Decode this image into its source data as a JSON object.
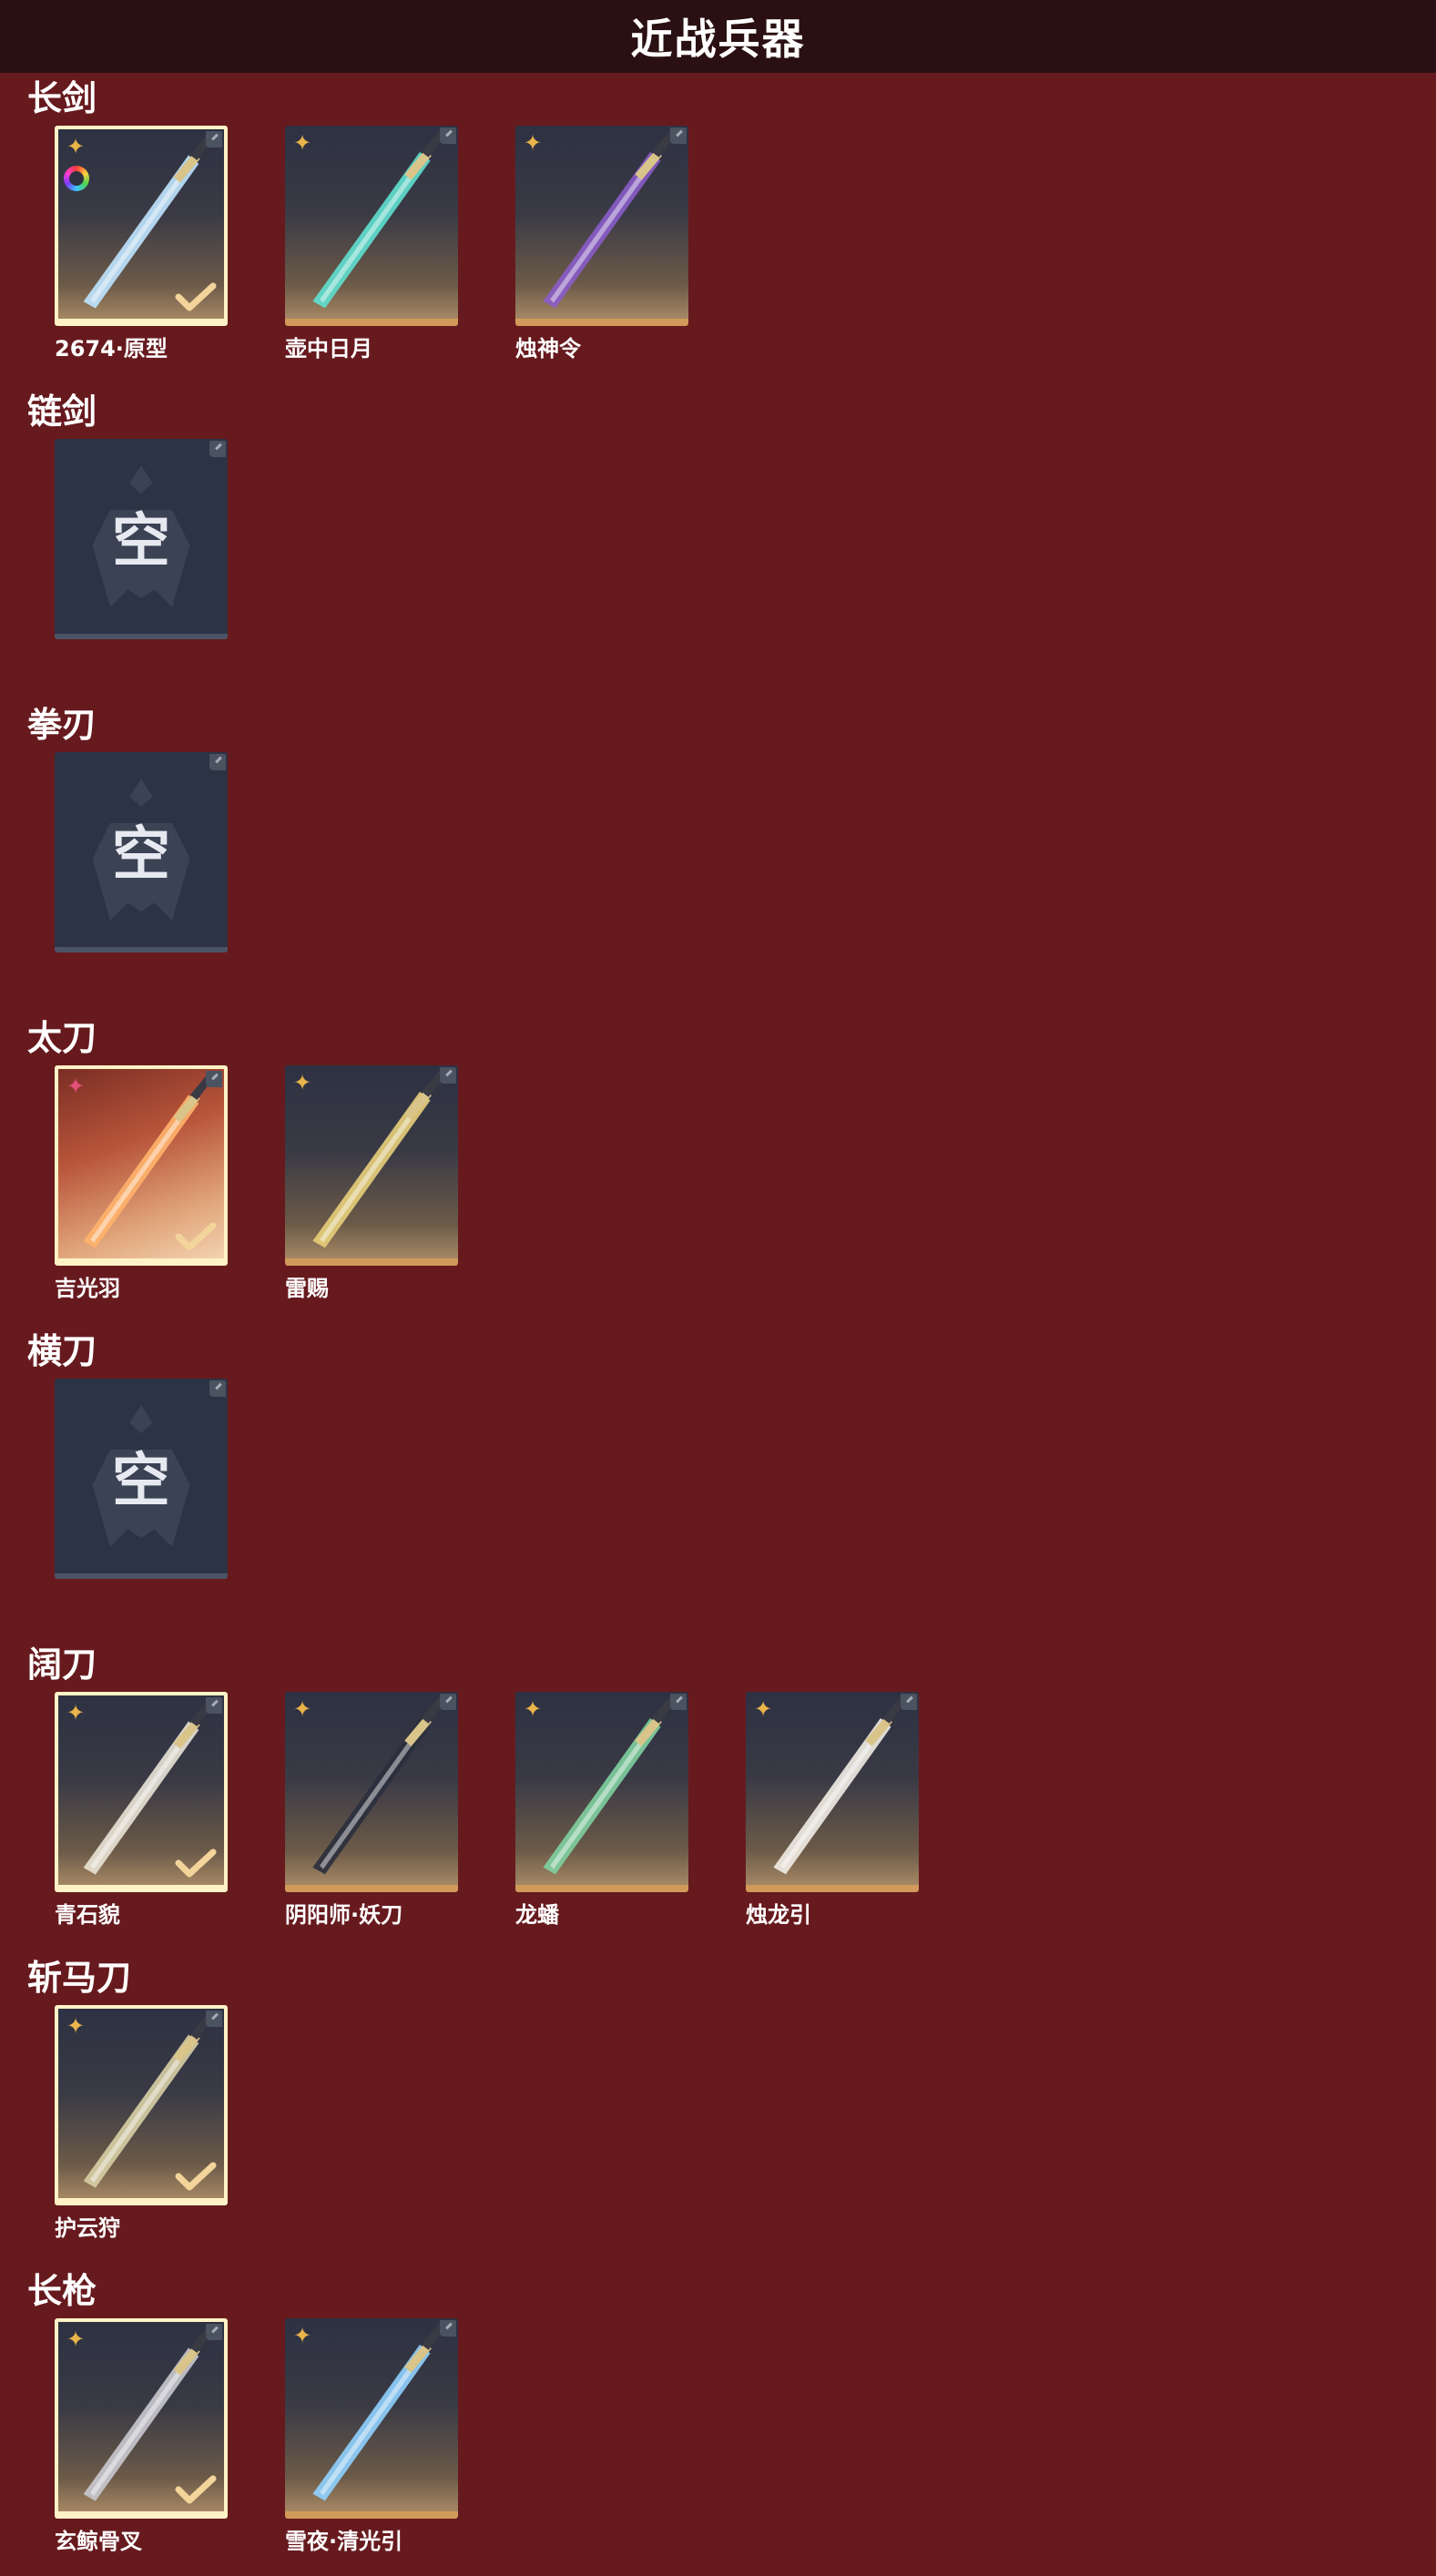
{
  "header": {
    "title": "近战兵器"
  },
  "sections": [
    {
      "title": "长剑",
      "items": [
        {
          "name": "2674·原型",
          "selected": true,
          "star": "gold",
          "ring": true,
          "blade_color": "#bfe4ff"
        },
        {
          "name": "壶中日月",
          "selected": false,
          "star": "gold",
          "blade_color": "#5fe0d0"
        },
        {
          "name": "烛神令",
          "selected": false,
          "star": "gold",
          "blade_color": "#8a5cc9"
        }
      ]
    },
    {
      "title": "链剑",
      "items": [
        {
          "empty": true,
          "empty_label": "空"
        }
      ]
    },
    {
      "title": "拳刃",
      "items": [
        {
          "empty": true,
          "empty_label": "空"
        }
      ]
    },
    {
      "title": "太刀",
      "items": [
        {
          "name": "吉光羽",
          "selected": true,
          "star": "pink",
          "blade_color": "#ffb36b"
        },
        {
          "name": "雷赐",
          "selected": false,
          "star": "gold",
          "blade_color": "#e8cf7a"
        }
      ]
    },
    {
      "title": "横刀",
      "items": [
        {
          "empty": true,
          "empty_label": "空"
        }
      ]
    },
    {
      "title": "阔刀",
      "items": [
        {
          "name": "青石貌",
          "selected": true,
          "star": "gold",
          "blade_color": "#e9e3d6"
        },
        {
          "name": "阴阳师·妖刀",
          "selected": false,
          "star": "gold",
          "blade_color": "#2b2f3d"
        },
        {
          "name": "龙蟠",
          "selected": false,
          "star": "gold",
          "blade_color": "#7fd0a0"
        },
        {
          "name": "烛龙引",
          "selected": false,
          "star": "gold",
          "blade_color": "#f1ece4"
        }
      ]
    },
    {
      "title": "斩马刀",
      "items": [
        {
          "name": "护云狩",
          "selected": true,
          "star": "gold",
          "blade_color": "#d8cfa5"
        }
      ]
    },
    {
      "title": "长枪",
      "items": [
        {
          "name": "玄鲸骨叉",
          "selected": true,
          "star": "gold",
          "blade_color": "#c9c9cf"
        },
        {
          "name": "雪夜·清光引",
          "selected": false,
          "star": "gold",
          "blade_color": "#8fd1ff"
        }
      ]
    }
  ],
  "icons": {
    "star": "star-badge-icon",
    "check": "check-icon",
    "corner": "corner-tag-icon"
  },
  "colors": {
    "background": "#671a1e",
    "header": "#2a1012",
    "selected_border": "#fff2c6",
    "rarity_bar": "#d19a5a"
  }
}
